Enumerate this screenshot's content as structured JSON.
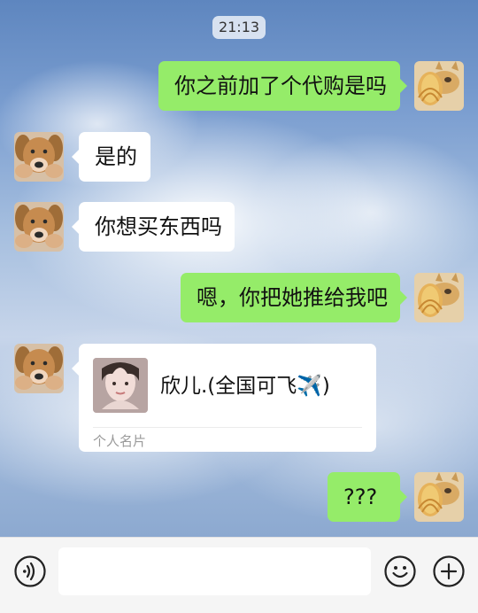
{
  "status": {
    "time": "21:13"
  },
  "chat": {
    "messages": [
      {
        "direction": "out",
        "text": "你之前加了个代购是吗",
        "avatar": "cat-avatar"
      },
      {
        "direction": "in",
        "text": "是的",
        "avatar": "dog-avatar"
      },
      {
        "direction": "in",
        "text": "你想买东西吗",
        "avatar": "dog-avatar"
      },
      {
        "direction": "out",
        "text": "嗯，你把她推给我吧",
        "avatar": "cat-avatar"
      },
      {
        "direction": "in",
        "type": "contact_card",
        "name": "欣儿.(全国可飞✈️)",
        "footer": "个人名片",
        "avatar": "dog-avatar",
        "thumbnail": "profile-photo"
      },
      {
        "direction": "out",
        "text": "???",
        "avatar": "cat-avatar"
      }
    ]
  },
  "input_bar": {
    "left_icon": "voice-icon",
    "emoji_icon": "emoji-icon",
    "plus_icon": "plus-icon"
  },
  "colors": {
    "out_bubble": "#95ec69",
    "in_bubble": "#ffffff",
    "input_bar_bg": "#f5f5f5"
  }
}
